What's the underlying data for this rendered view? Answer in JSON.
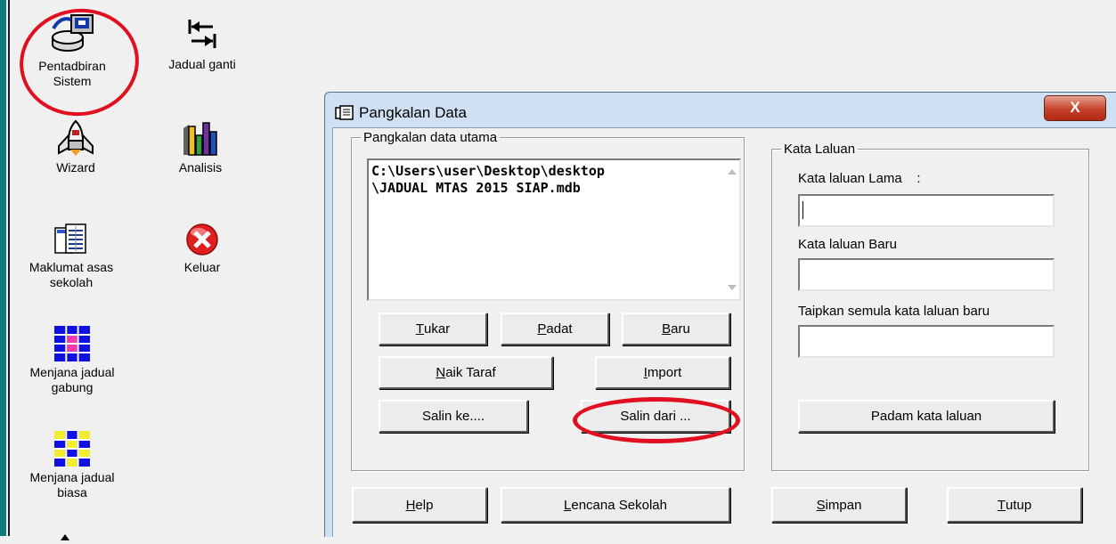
{
  "desktop": {
    "tools": [
      {
        "label_lines": [
          "Pentadbiran",
          "Sistem"
        ],
        "icon": "computer-icon"
      },
      {
        "label_lines": [
          "Jadual ganti"
        ],
        "icon": "swap-arrows-icon"
      },
      {
        "label_lines": [
          "Wizard"
        ],
        "icon": "rocket-icon"
      },
      {
        "label_lines": [
          "Analisis"
        ],
        "icon": "bar-chart-icon"
      },
      {
        "label_lines": [
          "Maklumat asas",
          "sekolah"
        ],
        "icon": "document-table-icon"
      },
      {
        "label_lines": [
          "Keluar"
        ],
        "icon": "red-x-icon"
      },
      {
        "label_lines": [
          "Menjana jadual",
          "gabung"
        ],
        "icon": "grid-pink-icon"
      },
      {
        "label_lines": [
          "Menjana jadual",
          "biasa"
        ],
        "icon": "grid-yellow-icon"
      }
    ]
  },
  "dialog": {
    "title": "Pangkalan Data",
    "close_label": "X",
    "db_group": {
      "legend": "Pangkalan data utama",
      "path_line1": "C:\\Users\\user\\Desktop\\desktop",
      "path_line2": "\\JADUAL MTAS 2015 SIAP.mdb",
      "buttons": {
        "tukar": {
          "mnemonic": "T",
          "rest": "ukar"
        },
        "padat": {
          "mnemonic": "P",
          "rest": "adat"
        },
        "baru": {
          "mnemonic": "B",
          "rest": "aru"
        },
        "naik_taraf": {
          "mnemonic": "N",
          "rest": "aik Taraf"
        },
        "import": {
          "mnemonic": "I",
          "rest": "mport"
        },
        "salin_ke": "Salin ke....",
        "salin_dari": "Salin dari ..."
      }
    },
    "password_group": {
      "legend": "Kata Laluan",
      "old_label": "Kata laluan Lama    :",
      "new_label": "Kata laluan Baru",
      "confirm_label": "Taipkan semula kata laluan baru",
      "old_value": "",
      "new_value": "",
      "confirm_value": "",
      "delete_button": "Padam kata laluan"
    },
    "footer": {
      "help": {
        "mnemonic": "H",
        "rest": "elp"
      },
      "badge": {
        "mnemonic": "L",
        "rest": "encana Sekolah"
      },
      "save": {
        "mnemonic": "S",
        "rest": "impan"
      },
      "close": {
        "mnemonic": "T",
        "rest": "utup"
      }
    }
  },
  "colors": {
    "highlight_ring": "#e01020",
    "title_bar": "#cfe0f2",
    "close_button": "#c4412a",
    "left_bar": "#0b7c7c"
  }
}
